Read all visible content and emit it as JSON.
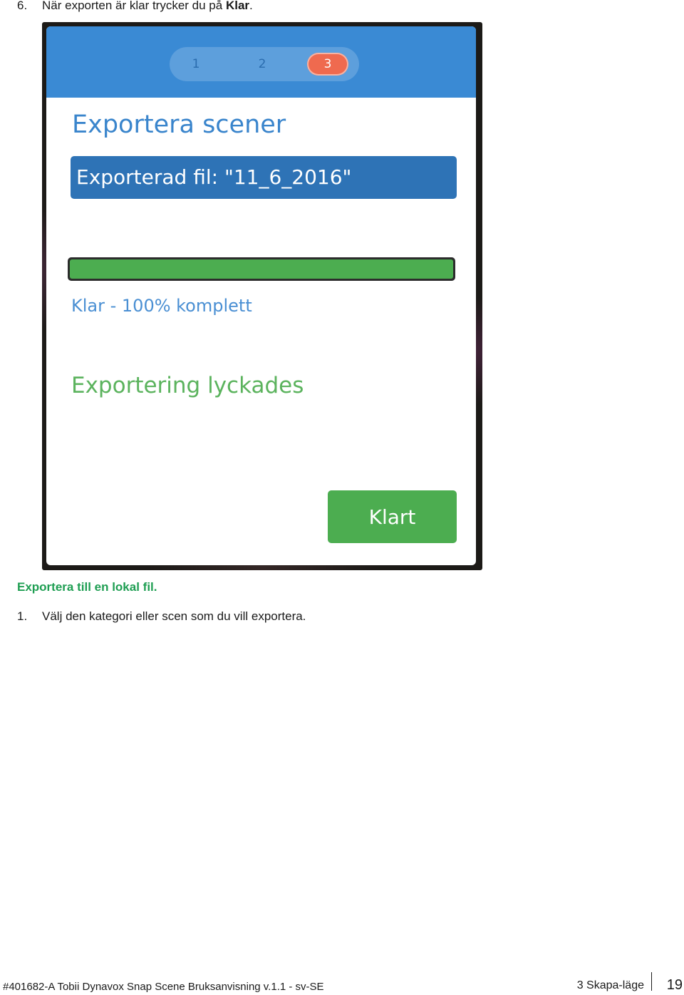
{
  "instructions": {
    "step6_number": "6.",
    "step6_text": "När exporten är klar trycker du på ",
    "step6_bold": "Klar",
    "step6_end": "."
  },
  "dialog": {
    "steps": [
      "1",
      "2",
      "3"
    ],
    "active_step": "3",
    "title": "Exportera scener",
    "exported_file": "Exporterad fil: \"11_6_2016\"",
    "progress": 1.0,
    "progress_text": "Klar - 100% komplett",
    "success_text": "Exportering lyckades",
    "done_button": "Klart",
    "colors": {
      "header": "#3a8ad4",
      "active_step": "#ef6a4f",
      "progress": "#4cad50",
      "button": "#4cad50"
    }
  },
  "section": {
    "heading": "Exportera till en lokal fil.",
    "heading_color": "#1e9e52",
    "step1_number": "1.",
    "step1_text": "Välj den kategori eller scen som du vill exportera."
  },
  "footer": {
    "document": "#401682-A Tobii Dynavox Snap Scene Bruksanvisning v.1.1 - sv-SE",
    "chapter": "3 Skapa-läge",
    "page": "19"
  }
}
